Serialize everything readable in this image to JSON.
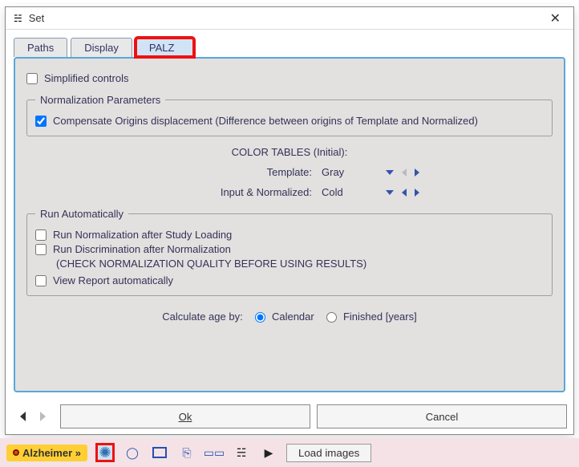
{
  "window": {
    "title": "Set"
  },
  "tabs": {
    "paths": "Paths",
    "display": "Display",
    "palz": "PALZ"
  },
  "simplified": {
    "label": "Simplified controls",
    "checked": false
  },
  "norm_params": {
    "legend": "Normalization Parameters",
    "compensate": {
      "label": "Compensate Origins displacement (Difference between origins of Template and Normalized)",
      "checked": true
    }
  },
  "color_tables": {
    "heading": "COLOR TABLES (Initial):",
    "template_label": "Template:",
    "template_value": "Gray",
    "input_label": "Input & Normalized:",
    "input_value": "Cold"
  },
  "run_auto": {
    "legend": "Run Automatically",
    "norm_after_load": {
      "label": "Run Normalization after Study Loading",
      "checked": false
    },
    "discrim_after_norm": {
      "label": "Run Discrimination after Normalization",
      "checked": false
    },
    "warning": "(CHECK NORMALIZATION QUALITY BEFORE USING RESULTS)",
    "view_report": {
      "label": "View Report automatically",
      "checked": false
    }
  },
  "calc_age": {
    "label": "Calculate age by:",
    "calendar": "Calendar",
    "finished": "Finished  [years]",
    "selected": "calendar"
  },
  "buttons": {
    "ok": "Ok",
    "cancel": "Cancel"
  },
  "taskbar": {
    "alzheimer": "Alzheimer »",
    "load_images": "Load images"
  }
}
